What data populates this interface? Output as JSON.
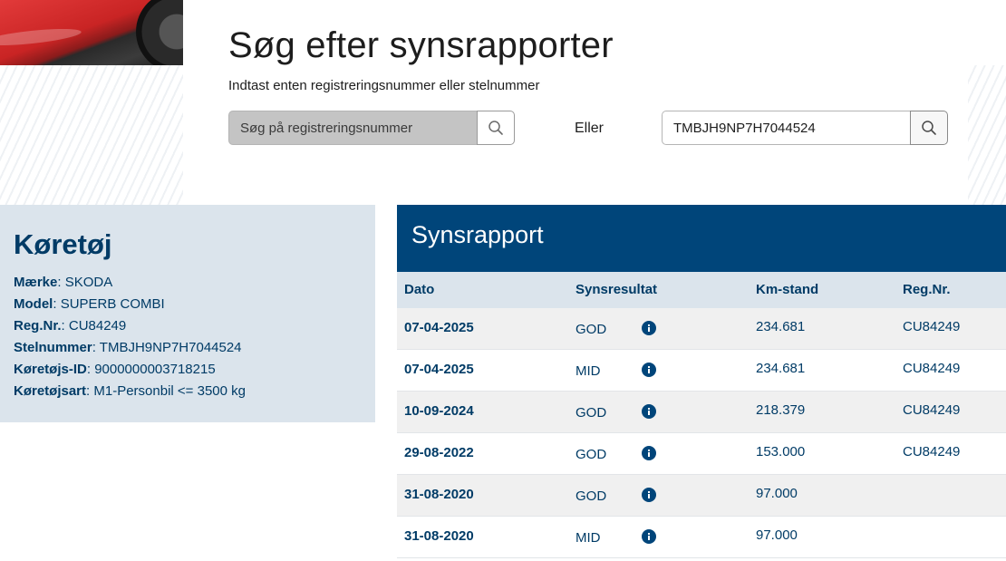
{
  "search": {
    "title": "Søg efter synsrapporter",
    "subtitle": "Indtast enten registreringsnummer eller stelnummer",
    "reg_placeholder": "Søg på registreringsnummer",
    "or_label": "Eller",
    "vin_value": "TMBJH9NP7H7044524",
    "search_icon": "search-icon"
  },
  "vehicle": {
    "title": "Køretøj",
    "fields": [
      {
        "label": "Mærke",
        "value": "SKODA"
      },
      {
        "label": "Model",
        "value": "SUPERB COMBI"
      },
      {
        "label": "Reg.Nr.",
        "value": "CU84249"
      },
      {
        "label": "Stelnummer",
        "value": "TMBJH9NP7H7044524"
      },
      {
        "label": "Køretøjs-ID",
        "value": "9000000003718215"
      },
      {
        "label": "Køretøjsart",
        "value": "M1-Personbil <= 3500 kg"
      }
    ]
  },
  "report": {
    "title": "Synsrapport",
    "columns": [
      "Dato",
      "Synsresultat",
      "Km-stand",
      "Reg.Nr."
    ],
    "rows": [
      {
        "date": "07-04-2025",
        "result": "GOD",
        "km": "234.681",
        "reg": "CU84249"
      },
      {
        "date": "07-04-2025",
        "result": "MID",
        "km": "234.681",
        "reg": "CU84249"
      },
      {
        "date": "10-09-2024",
        "result": "GOD",
        "km": "218.379",
        "reg": "CU84249"
      },
      {
        "date": "29-08-2022",
        "result": "GOD",
        "km": "153.000",
        "reg": "CU84249"
      },
      {
        "date": "31-08-2020",
        "result": "GOD",
        "km": "97.000",
        "reg": ""
      },
      {
        "date": "31-08-2020",
        "result": "MID",
        "km": "97.000",
        "reg": ""
      }
    ],
    "info_icon": "info-icon"
  },
  "colors": {
    "primary": "#00457a",
    "text": "#003b66",
    "panel": "#dbe4ec",
    "row_alt": "#f0f0f0"
  }
}
